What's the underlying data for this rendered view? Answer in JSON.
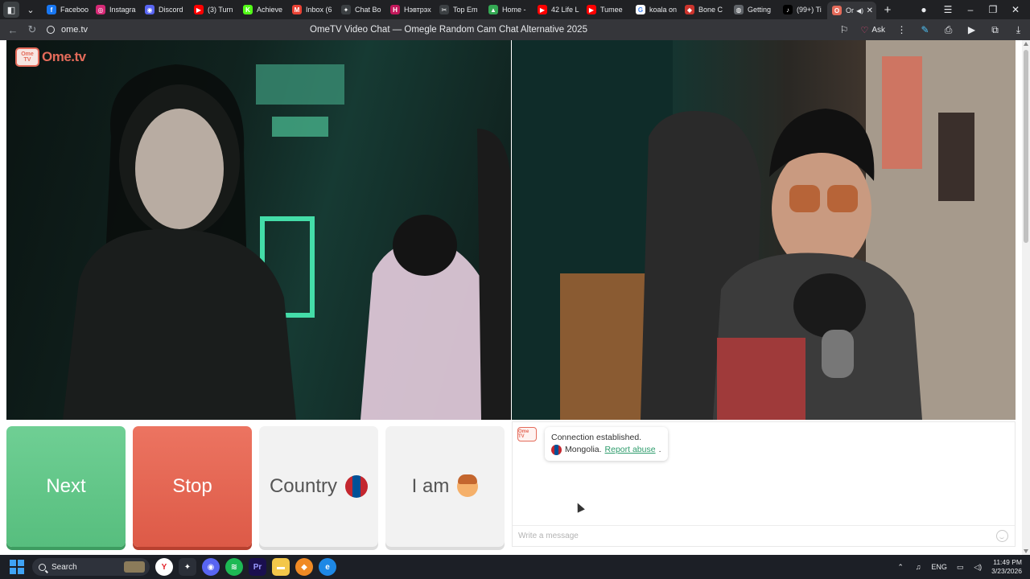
{
  "tabs": [
    {
      "title": "Faceboo",
      "icon": "facebook-icon",
      "color": "#1877f2",
      "glyph": "f"
    },
    {
      "title": "Instagra",
      "icon": "instagram-icon",
      "color": "#d62976",
      "glyph": "◎"
    },
    {
      "title": "Discord",
      "icon": "discord-icon",
      "color": "#5865f2",
      "glyph": "◉"
    },
    {
      "title": "(3) Turn",
      "icon": "youtube-icon",
      "color": "#ff0000",
      "glyph": "▶"
    },
    {
      "title": "Achieve",
      "icon": "kick-icon",
      "color": "#53fc18",
      "glyph": "K"
    },
    {
      "title": "Inbox (6",
      "icon": "gmail-icon",
      "color": "#ea4335",
      "glyph": "M"
    },
    {
      "title": "Chat Bo",
      "icon": "openai-icon",
      "color": "#3c4043",
      "glyph": "✦"
    },
    {
      "title": "Нэвтрэх",
      "icon": "app-icon",
      "color": "#c2185b",
      "glyph": "H"
    },
    {
      "title": "Top Em",
      "icon": "capcut-icon",
      "color": "#3c4043",
      "glyph": "✂"
    },
    {
      "title": "Home -",
      "icon": "drive-icon",
      "color": "#34a853",
      "glyph": "▲"
    },
    {
      "title": "42 Life L",
      "icon": "youtube-icon",
      "color": "#ff0000",
      "glyph": "▶"
    },
    {
      "title": "Tumee",
      "icon": "youtube-icon",
      "color": "#ff0000",
      "glyph": "▶"
    },
    {
      "title": "koala on",
      "icon": "google-icon",
      "color": "#ffffff",
      "glyph": "G"
    },
    {
      "title": "Bone C",
      "icon": "ruby-icon",
      "color": "#cc342d",
      "glyph": "◆"
    },
    {
      "title": "Getting",
      "icon": "globe-icon",
      "color": "#5f6368",
      "glyph": "◍"
    },
    {
      "title": "(99+) Ti",
      "icon": "tiktok-icon",
      "color": "#000000",
      "glyph": "♪"
    },
    {
      "title": "Or",
      "icon": "ometv-icon",
      "color": "#e46b5a",
      "glyph": "O",
      "active": true
    }
  ],
  "address": {
    "url": "ome.tv",
    "page_title": "OmeTV Video Chat — Omegle Random Cam Chat Alternative 2025",
    "ask_label": "Ask"
  },
  "site": {
    "logo_badge": "Ome TV",
    "logo_word": "Ome.tv"
  },
  "buttons": {
    "next": "Next",
    "stop": "Stop",
    "country": "Country",
    "iam": "I am"
  },
  "chat": {
    "icon_text": "Ome TV",
    "status": "Connection established.",
    "country": "Mongolia.",
    "report": "Report abuse",
    "report_suffix": ".",
    "placeholder": "Write a message"
  },
  "taskbar": {
    "search_label": "Search",
    "language": "ENG",
    "time": "11:49 PM",
    "date": "3/23/2026"
  },
  "colors": {
    "next": "#5ec485",
    "stop": "#e4634f",
    "brand": "#e46b5a",
    "link": "#2e9c6c"
  }
}
